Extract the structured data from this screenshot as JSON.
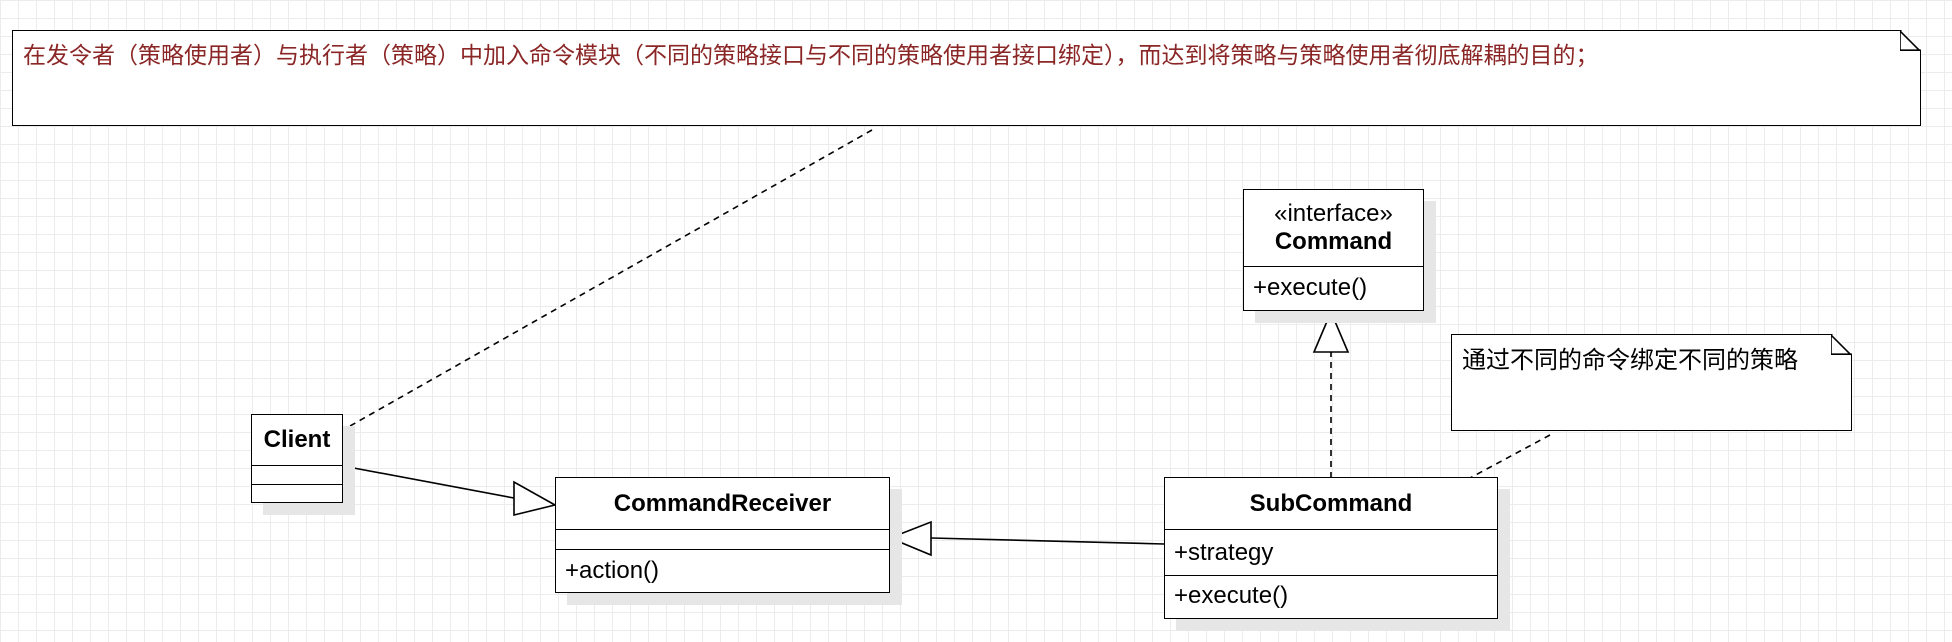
{
  "diagram": {
    "notes": {
      "top": "在发令者（策略使用者）与执行者（策略）中加入命令模块（不同的策略接口与不同的策略使用者接口绑定），而达到将策略与策略使用者彻底解耦的目的；",
      "side": "通过不同的命令绑定不同的策略"
    },
    "classes": {
      "client": {
        "name": "Client"
      },
      "command": {
        "stereotype": "«interface»",
        "name": "Command",
        "method": "+execute()"
      },
      "receiver": {
        "name": "CommandReceiver",
        "method": "+action()"
      },
      "subcommand": {
        "name": "SubCommand",
        "attribute": "+strategy",
        "method": "+execute()"
      }
    },
    "colors": {
      "note_text": "#8b2626",
      "grid": "#ececec",
      "shadow": "#e6e6e6"
    }
  }
}
